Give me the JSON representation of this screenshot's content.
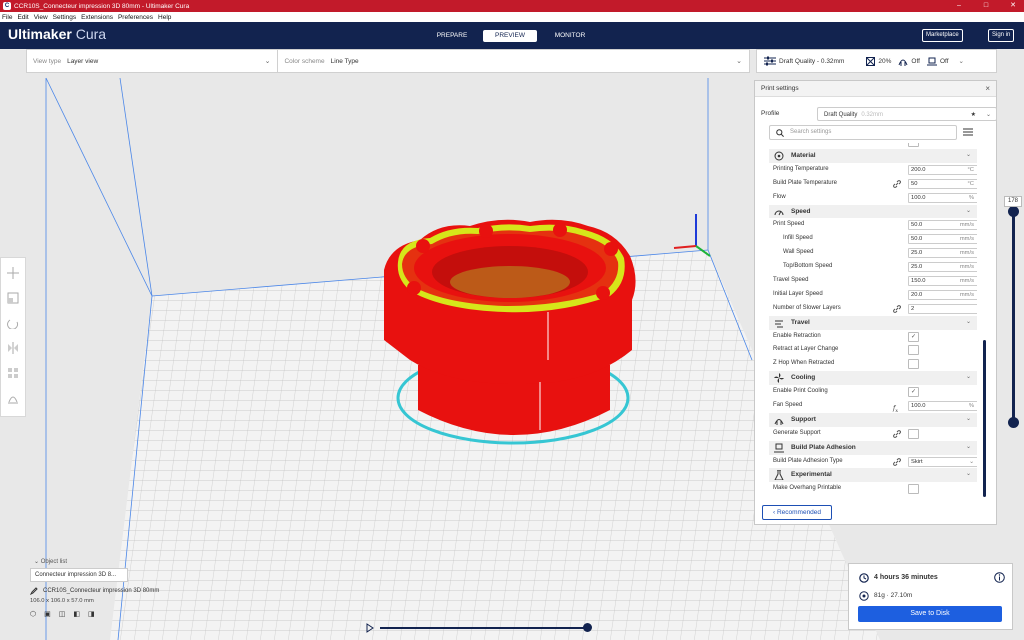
{
  "window": {
    "title": "CCR10S_Connecteur impression 3D 80mm - Ultimaker Cura",
    "controls": [
      "–",
      "□",
      "✕"
    ]
  },
  "menu": [
    "File",
    "Edit",
    "View",
    "Settings",
    "Extensions",
    "Preferences",
    "Help"
  ],
  "header": {
    "logo_bold": "Ultimaker",
    "logo_light": " Cura",
    "stages": [
      "PREPARE",
      "PREVIEW",
      "MONITOR"
    ],
    "active_stage": "PREVIEW",
    "marketplace": "Marketplace",
    "signin": "Sign in"
  },
  "viewbar": {
    "view_type_label": "View type",
    "view_type_value": "Layer view",
    "color_scheme_label": "Color scheme",
    "color_scheme_value": "Line Type"
  },
  "quality": {
    "profile": "Draft Quality - 0.32mm",
    "infill": "20%",
    "support": "Off",
    "adhesion": "Off"
  },
  "print_settings": {
    "title": "Print settings",
    "profile_label": "Profile",
    "profile_value": "Draft Quality",
    "profile_dim": "0.32mm",
    "search_placeholder": "Search settings",
    "recommended": "Recommended",
    "rows": [
      {
        "type": "cat",
        "label": "Material"
      },
      {
        "type": "val",
        "label": "Printing Temperature",
        "value": "200.0",
        "unit": "°C"
      },
      {
        "type": "val",
        "label": "Build Plate Temperature",
        "value": "50",
        "unit": "°C",
        "link": true
      },
      {
        "type": "val",
        "label": "Flow",
        "value": "100.0",
        "unit": "%"
      },
      {
        "type": "cat",
        "label": "Speed"
      },
      {
        "type": "val",
        "label": "Print Speed",
        "value": "50.0",
        "unit": "mm/s"
      },
      {
        "type": "val",
        "label": "Infill Speed",
        "value": "50.0",
        "unit": "mm/s",
        "indent": true
      },
      {
        "type": "val",
        "label": "Wall Speed",
        "value": "25.0",
        "unit": "mm/s",
        "indent": true
      },
      {
        "type": "val",
        "label": "Top/Bottom Speed",
        "value": "25.0",
        "unit": "mm/s",
        "indent": true
      },
      {
        "type": "val",
        "label": "Travel Speed",
        "value": "150.0",
        "unit": "mm/s"
      },
      {
        "type": "val",
        "label": "Initial Layer Speed",
        "value": "20.0",
        "unit": "mm/s"
      },
      {
        "type": "val",
        "label": "Number of Slower Layers",
        "value": "2",
        "unit": "",
        "link": true
      },
      {
        "type": "cat",
        "label": "Travel"
      },
      {
        "type": "chk",
        "label": "Enable Retraction",
        "checked": true
      },
      {
        "type": "chk",
        "label": "Retract at Layer Change",
        "checked": false
      },
      {
        "type": "chk",
        "label": "Z Hop When Retracted",
        "checked": false
      },
      {
        "type": "cat",
        "label": "Cooling"
      },
      {
        "type": "chk",
        "label": "Enable Print Cooling",
        "checked": true
      },
      {
        "type": "val",
        "label": "Fan Speed",
        "value": "100.0",
        "unit": "%",
        "fx": true
      },
      {
        "type": "cat",
        "label": "Support"
      },
      {
        "type": "chk",
        "label": "Generate Support",
        "checked": false,
        "link": true
      },
      {
        "type": "cat",
        "label": "Build Plate Adhesion"
      },
      {
        "type": "sel",
        "label": "Build Plate Adhesion Type",
        "value": "Skirt",
        "link": true
      },
      {
        "type": "cat",
        "label": "Experimental"
      },
      {
        "type": "chk",
        "label": "Make Overhang Printable",
        "checked": false
      }
    ]
  },
  "layer_slider": {
    "value": "178"
  },
  "object_list": {
    "header": "Object list",
    "item": "Connecteur impression 3D 8...",
    "file": "CCR10S_Connecteur impression 3D 80mm",
    "dims": "106.0 x 106.0 x 57.0 mm"
  },
  "job": {
    "time": "4 hours 36 minutes",
    "material": "81g · 27.10m",
    "save": "Save to Disk"
  },
  "colors": {
    "header": "#12234f",
    "titlebar": "#c21a2a",
    "accent": "#1d5fe0",
    "model": "#e8110f",
    "skin": "#d6e61a",
    "skirt": "#36c6d3"
  }
}
